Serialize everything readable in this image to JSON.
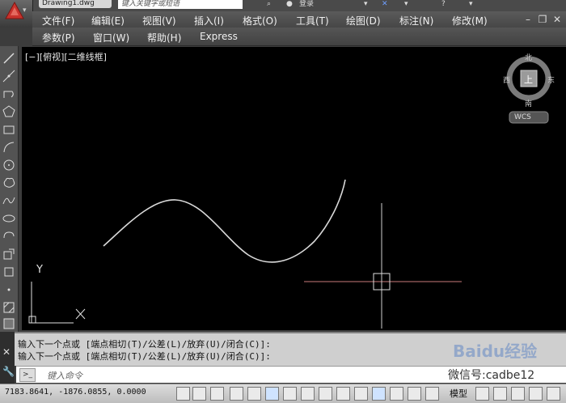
{
  "titlebar": {
    "document_tab": "Drawing1.dwg",
    "search_placeholder": "键入关键字或短语",
    "signin_label": "登录"
  },
  "menubar": {
    "row1": [
      "文件(F)",
      "编辑(E)",
      "视图(V)",
      "插入(I)",
      "格式(O)",
      "工具(T)",
      "绘图(D)",
      "标注(N)",
      "修改(M)"
    ],
    "row2": [
      "参数(P)",
      "窗口(W)",
      "帮助(H)",
      "Express"
    ]
  },
  "viewport": {
    "label": "[−][俯视][二维线框]",
    "viewcube": {
      "north": "北",
      "south": "南",
      "east": "东",
      "west": "西",
      "top": "上",
      "wcs": "WCS"
    },
    "ucs": {
      "y_label": "Y",
      "x_label": "X"
    }
  },
  "command": {
    "history": [
      "输入下一个点或 [端点相切(T)/公差(L)/放弃(U)/闭合(C)]:",
      "输入下一个点或 [端点相切(T)/公差(L)/放弃(U)/闭合(C)]:"
    ],
    "input_placeholder": "键入命令",
    "prompt_icon": "command-prompt-icon"
  },
  "status": {
    "coordinates": "7183.8641, -1876.0855, 0.0000",
    "model_label": "模型"
  },
  "watermark": {
    "brand": "Baidu经验",
    "account": "微信号:cadbe12"
  },
  "colors": {
    "canvas": "#000000",
    "spline": "#d9d9d9",
    "crosshair_h": "#c87a7a",
    "crosshair_v": "#d0d0d0"
  }
}
